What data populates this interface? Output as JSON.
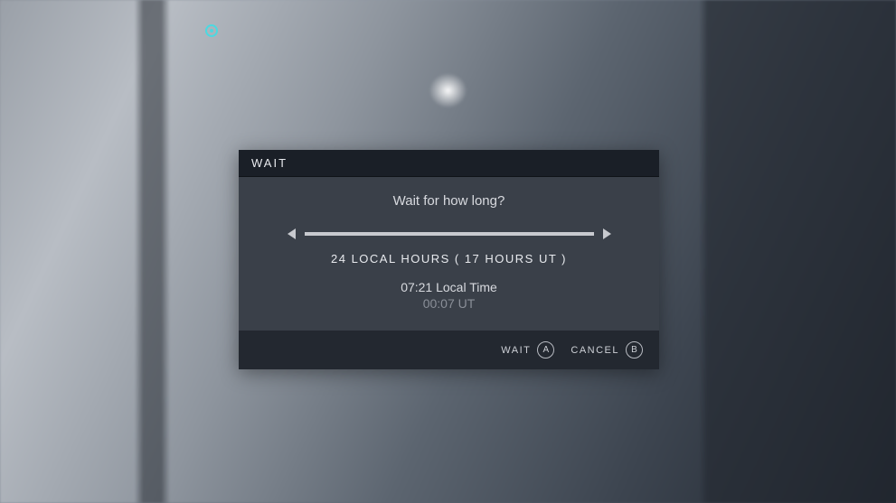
{
  "dialog": {
    "title": "WAIT",
    "prompt": "Wait for how long?",
    "duration_text": "24 LOCAL HOURS  ( 17 HOURS  UT )",
    "local_time": "07:21 Local Time",
    "ut_time": "00:07 UT",
    "actions": {
      "wait": {
        "label": "WAIT",
        "key": "A"
      },
      "cancel": {
        "label": "CANCEL",
        "key": "B"
      }
    }
  }
}
